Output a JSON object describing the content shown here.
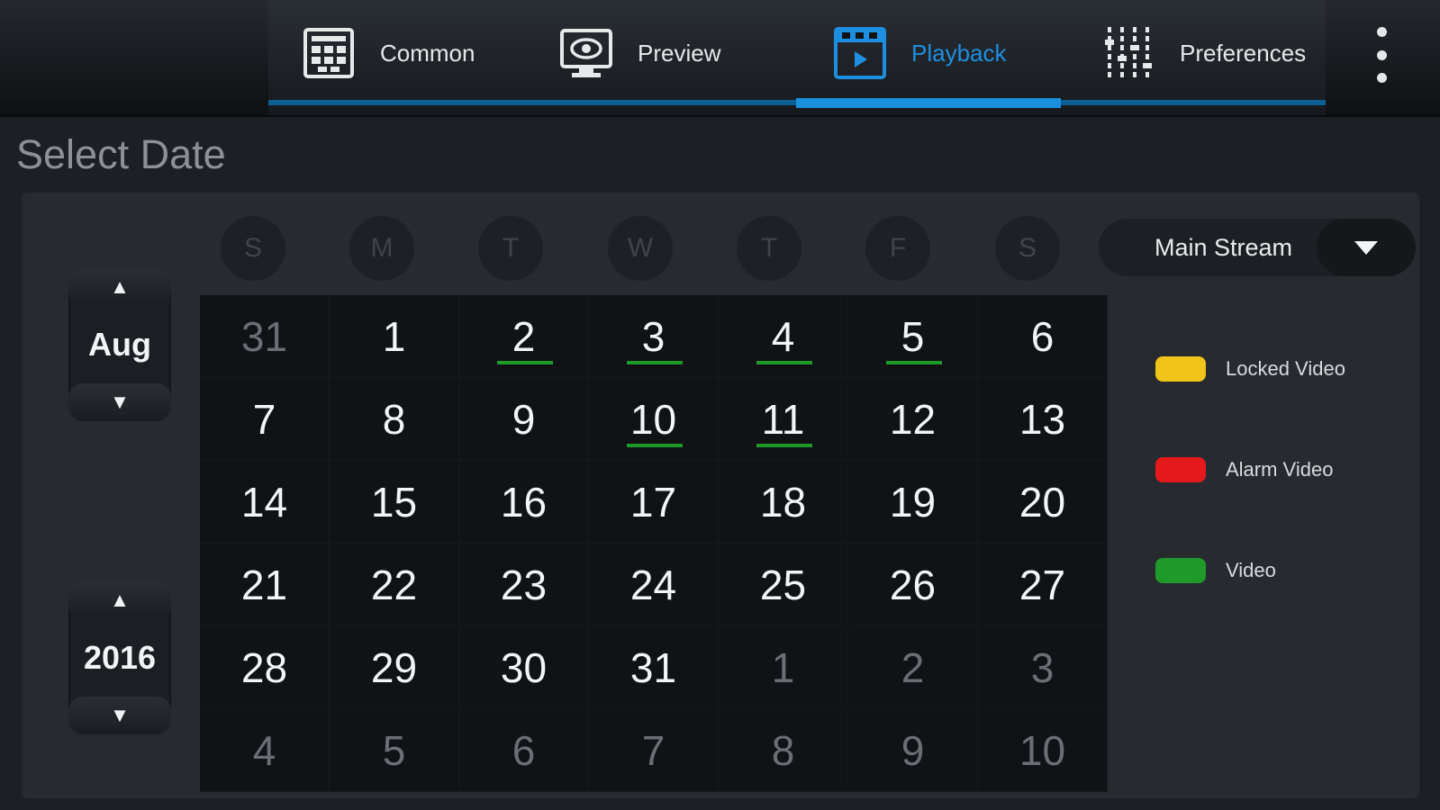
{
  "tabs": [
    {
      "label": "Common",
      "icon": "grid-schedule-icon",
      "active": false
    },
    {
      "label": "Preview",
      "icon": "monitor-eye-icon",
      "active": false
    },
    {
      "label": "Playback",
      "icon": "film-play-icon",
      "active": true
    },
    {
      "label": "Preferences",
      "icon": "sliders-icon",
      "active": false
    }
  ],
  "colors": {
    "accent": "#1a8fdb",
    "video": "#1f9a2a",
    "locked": "#f0c419",
    "alarm": "#e3191c"
  },
  "title": "Select Date",
  "month": "Aug",
  "year": "2016",
  "weekdays": [
    "S",
    "M",
    "T",
    "W",
    "T",
    "F",
    "S"
  ],
  "calendar": [
    [
      {
        "d": "31",
        "muted": true
      },
      {
        "d": "1"
      },
      {
        "d": "2",
        "video": true
      },
      {
        "d": "3",
        "video": true
      },
      {
        "d": "4",
        "video": true
      },
      {
        "d": "5",
        "video": true
      },
      {
        "d": "6"
      }
    ],
    [
      {
        "d": "7"
      },
      {
        "d": "8"
      },
      {
        "d": "9"
      },
      {
        "d": "10",
        "video": true
      },
      {
        "d": "11",
        "video": true
      },
      {
        "d": "12"
      },
      {
        "d": "13"
      }
    ],
    [
      {
        "d": "14"
      },
      {
        "d": "15"
      },
      {
        "d": "16"
      },
      {
        "d": "17"
      },
      {
        "d": "18"
      },
      {
        "d": "19"
      },
      {
        "d": "20"
      }
    ],
    [
      {
        "d": "21"
      },
      {
        "d": "22"
      },
      {
        "d": "23"
      },
      {
        "d": "24"
      },
      {
        "d": "25"
      },
      {
        "d": "26"
      },
      {
        "d": "27"
      }
    ],
    [
      {
        "d": "28"
      },
      {
        "d": "29"
      },
      {
        "d": "30"
      },
      {
        "d": "31"
      },
      {
        "d": "1",
        "muted": true
      },
      {
        "d": "2",
        "muted": true
      },
      {
        "d": "3",
        "muted": true
      }
    ],
    [
      {
        "d": "4",
        "muted": true
      },
      {
        "d": "5",
        "muted": true
      },
      {
        "d": "6",
        "muted": true
      },
      {
        "d": "7",
        "muted": true
      },
      {
        "d": "8",
        "muted": true
      },
      {
        "d": "9",
        "muted": true
      },
      {
        "d": "10",
        "muted": true
      }
    ]
  ],
  "stream": {
    "selected": "Main Stream"
  },
  "legend": [
    {
      "label": "Locked Video",
      "color": "#f0c419"
    },
    {
      "label": "Alarm Video",
      "color": "#e3191c"
    },
    {
      "label": "Video",
      "color": "#1f9a2a"
    }
  ]
}
